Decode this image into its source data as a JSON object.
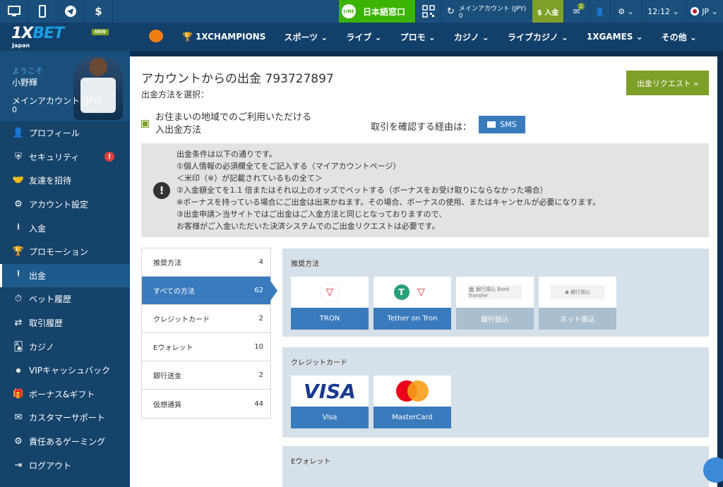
{
  "topbar": {
    "icons": [
      "desktop-icon",
      "mobile-icon",
      "telegram-icon",
      "dollar-icon"
    ],
    "dollar_symbol": "$",
    "line_badge": "LINE",
    "line_label": "日本語窓口",
    "account_label": "メインアカウント (JPY)",
    "account_value": "0",
    "deposit_label": "$ 入金",
    "mail_count": "1",
    "time": "12:12",
    "lang": "JP"
  },
  "nav": {
    "logo_main": "1X",
    "logo_accent": "BET",
    "logo_sub": "Japan",
    "new_badge": "NEW",
    "items": [
      "1XCHAMPIONS",
      "スポーツ",
      "ライブ",
      "プロモ",
      "カジノ",
      "ライブカジノ",
      "1XGAMES",
      "その他"
    ]
  },
  "sidebar": {
    "welcome": "ようこそ",
    "name": "小野輝",
    "account_label": "メインアカウント (JPY)",
    "balance": "0",
    "items": [
      {
        "label": "プロフィール",
        "icon": "user-plus-icon",
        "glyph": "👤"
      },
      {
        "label": "セキュリティ",
        "icon": "shield-icon",
        "glyph": "⛨"
      },
      {
        "label": "友達を招待",
        "icon": "handshake-icon",
        "glyph": "🤝"
      },
      {
        "label": "アカウント設定",
        "icon": "gears-icon",
        "glyph": "⚙"
      },
      {
        "label": "入金",
        "icon": "download-icon",
        "glyph": "⭳"
      },
      {
        "label": "プロモーション",
        "icon": "trophy-icon",
        "glyph": "🏆"
      },
      {
        "label": "出金",
        "icon": "upload-icon",
        "glyph": "⭱"
      },
      {
        "label": "ベット履歴",
        "icon": "history-icon",
        "glyph": "⏱"
      },
      {
        "label": "取引履歴",
        "icon": "exchange-icon",
        "glyph": "⇄"
      },
      {
        "label": "カジノ",
        "icon": "cards-icon",
        "glyph": "🂡"
      },
      {
        "label": "VIPキャッシュバック",
        "icon": "dot-icon",
        "glyph": ""
      },
      {
        "label": "ボーナス&ギフト",
        "icon": "gift-icon",
        "glyph": "🎁"
      },
      {
        "label": "カスタマーサポート",
        "icon": "envelope-icon",
        "glyph": "✉"
      },
      {
        "label": "責任あるゲーミング",
        "icon": "gears-icon",
        "glyph": "⚙"
      },
      {
        "label": "ログアウト",
        "icon": "logout-icon",
        "glyph": "⇥"
      }
    ],
    "alert_mark": "!"
  },
  "main": {
    "title": "アカウントからの出金 793727897",
    "subtitle": "出金方法を選択：",
    "request_button": "出金リクエスト  »",
    "region_line1": "お住まいの地域でのご利用いただける",
    "region_line2": "入出金方法",
    "confirm_label": "取引を確認する経由は：",
    "sms_label": "SMS",
    "notice": [
      "出金条件は以下の通りです。",
      "①個人情報の必須欄全てをご記入する（マイアカウントページ）",
      "＜米印（※）が記載されているもの全て＞",
      "②入金額全てを1.1 倍またはそれ以上のオッズでベットする（ボーナスをお受け取りにならなかった場合）",
      "※ボーナスを持っている場合にご出金は出来かねます。その場合、ボーナスの使用、またはキャンセルが必要になります。",
      "③出金申請＞当サイトではご出金はご入金方法と同じとなっておりますので、",
      "お客様がご入金いただいた決済システムでのご出金リクエストは必要です。"
    ],
    "notice_mark": "!",
    "methods": [
      {
        "label": "推奨方法",
        "count": "4"
      },
      {
        "label": "すべての方法",
        "count": "62"
      },
      {
        "label": "クレジットカード",
        "count": "2"
      },
      {
        "label": "Eウォレット",
        "count": "10"
      },
      {
        "label": "銀行送金",
        "count": "2"
      },
      {
        "label": "仮想通貨",
        "count": "44"
      }
    ],
    "sections": [
      {
        "title": "推奨方法",
        "cards": [
          {
            "label": "TRON",
            "logo": "tron-logo-icon",
            "mark": "▽"
          },
          {
            "label": "Tether on Tron",
            "logo": "tether-logo-icon",
            "mark": "T"
          },
          {
            "label": "銀行振込",
            "logo": "bank-transfer-logo-icon",
            "mark": "🏛 銀行振込 Bank Transfer"
          },
          {
            "label": "ネット振込",
            "logo": "net-transfer-logo-icon",
            "mark": "◉ 銀行振込"
          }
        ]
      },
      {
        "title": "クレジットカード",
        "cards": [
          {
            "label": "Visa",
            "logo": "visa-logo-icon",
            "mark": "VISA"
          },
          {
            "label": "MasterCard",
            "logo": "mastercard-logo-icon",
            "mark": ""
          }
        ]
      },
      {
        "title": "Eウォレット"
      }
    ]
  },
  "colors": {
    "brand": "#12406b",
    "accent": "#7e9f28",
    "selected": "#3a7bbd"
  }
}
